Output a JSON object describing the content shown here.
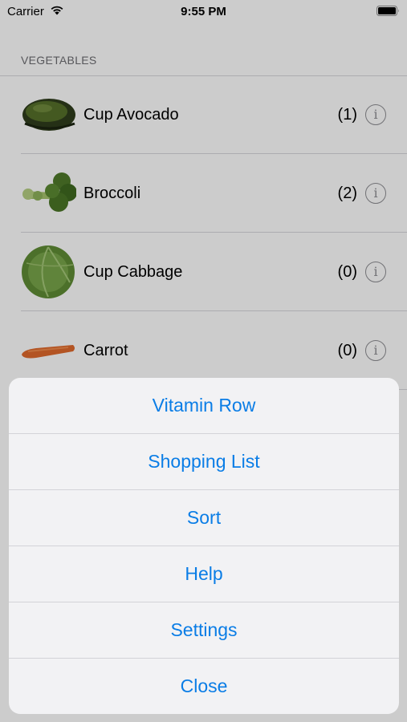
{
  "status_bar": {
    "carrier": "Carrier",
    "time": "9:55 PM"
  },
  "section": {
    "header": "VEGETABLES"
  },
  "items": [
    {
      "name": "Cup Avocado",
      "count": "(1)",
      "image": "avocado-image"
    },
    {
      "name": "Broccoli",
      "count": "(2)",
      "image": "broccoli-image"
    },
    {
      "name": "Cup Cabbage",
      "count": "(0)",
      "image": "cabbage-image"
    },
    {
      "name": "Carrot",
      "count": "(0)",
      "image": "carrot-image"
    }
  ],
  "action_sheet": {
    "items": [
      "Vitamin Row",
      "Shopping List",
      "Sort",
      "Help",
      "Settings",
      "Close"
    ]
  },
  "colors": {
    "accent": "#0a7de6",
    "secondary_text": "#6d6d72"
  }
}
